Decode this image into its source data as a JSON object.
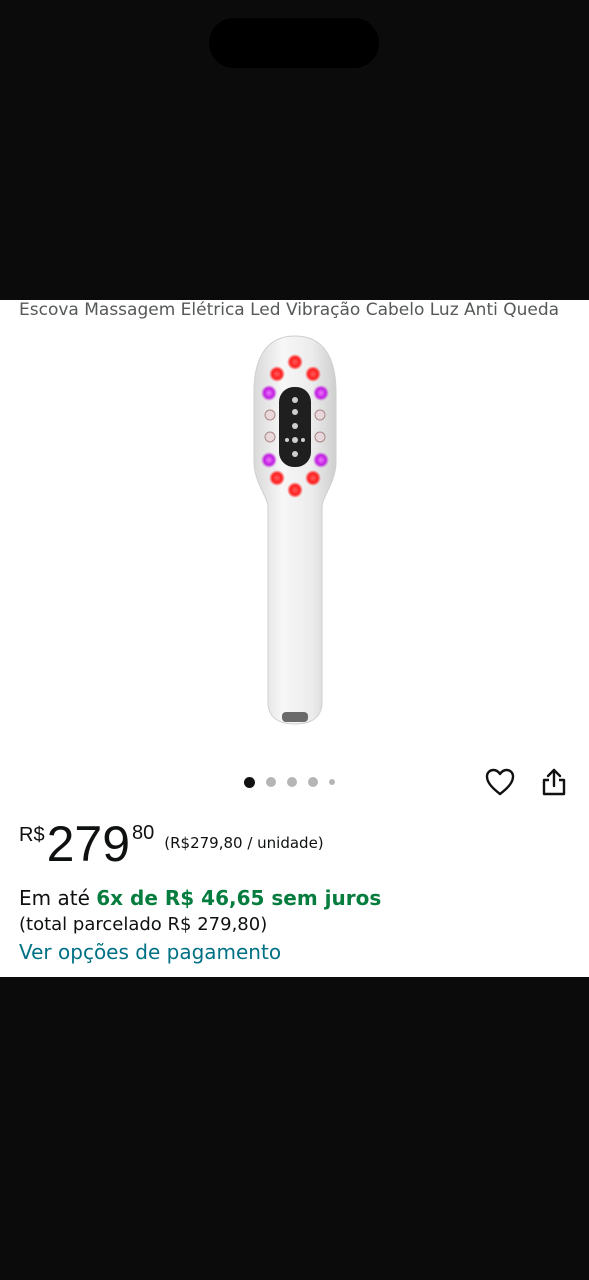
{
  "product": {
    "title": "Escova Massagem Elétrica Led Vibração Cabelo Luz Anti Queda",
    "image_icon": "led-hair-brush-image"
  },
  "gallery": {
    "dot_count": 5,
    "active_index": 0
  },
  "actions": {
    "favorite_icon": "heart-icon",
    "share_icon": "share-icon"
  },
  "price": {
    "currency": "R$",
    "whole": "279",
    "fraction": "80",
    "unit_price": "(R$279,80 / unidade)"
  },
  "installments": {
    "prefix": "Em até ",
    "highlight": "6x de R$ 46,65 sem juros",
    "total": "(total parcelado R$ 279,80)",
    "payment_link": "Ver opções de pagamento"
  },
  "colors": {
    "link": "#007185",
    "green": "#067d3e",
    "text": "#0f1111",
    "secondary_text": "#565959"
  }
}
